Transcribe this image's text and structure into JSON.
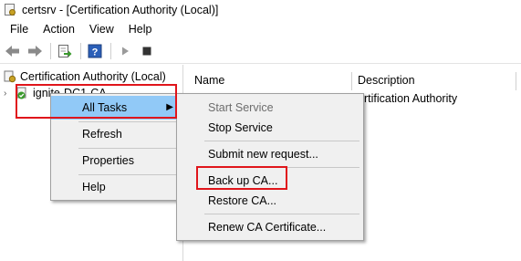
{
  "window": {
    "title": "certsrv - [Certification Authority (Local)]"
  },
  "menubar": {
    "items": [
      "File",
      "Action",
      "View",
      "Help"
    ]
  },
  "tree": {
    "root_label": "Certification Authority (Local)",
    "child_label": "ignite-DC1-CA"
  },
  "list": {
    "columns": [
      "Name",
      "Description"
    ],
    "row_description": "ertification Authority"
  },
  "context_menu": {
    "items": [
      "All Tasks",
      "Refresh",
      "Properties",
      "Help"
    ]
  },
  "submenu": {
    "items": [
      {
        "label": "Start Service",
        "disabled": true
      },
      {
        "label": "Stop Service",
        "disabled": false
      },
      {
        "label": "Submit new request...",
        "disabled": false
      },
      {
        "label": "Back up CA...",
        "disabled": false
      },
      {
        "label": "Restore CA...",
        "disabled": false
      },
      {
        "label": "Renew CA Certificate...",
        "disabled": false
      }
    ]
  },
  "colors": {
    "highlight": "#91c9f7",
    "annotation": "#e0151b",
    "menu_bg": "#f0f0f0"
  }
}
